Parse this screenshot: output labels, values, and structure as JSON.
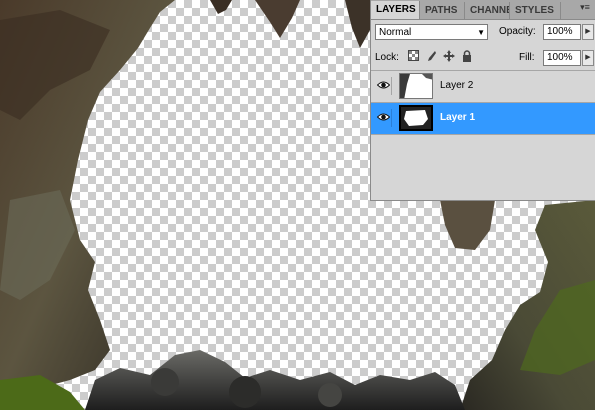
{
  "panel": {
    "tabs": [
      "LAYERS",
      "PATHS",
      "CHANNE",
      "STYLES"
    ],
    "menu_icon": "panel-menu-icon",
    "blend_mode": "Normal",
    "opacity_label": "Opacity:",
    "opacity_value": "100%",
    "lock_label": "Lock:",
    "fill_label": "Fill:",
    "fill_value": "100%",
    "lock_icons": [
      "lock-transparent-pixels-icon",
      "lock-image-pixels-icon",
      "lock-position-icon",
      "lock-all-icon"
    ],
    "layers": [
      {
        "name": "Layer 2",
        "visible": true,
        "selected": false
      },
      {
        "name": "Layer 1",
        "visible": true,
        "selected": true
      }
    ],
    "selection_color": "#3399ff"
  }
}
